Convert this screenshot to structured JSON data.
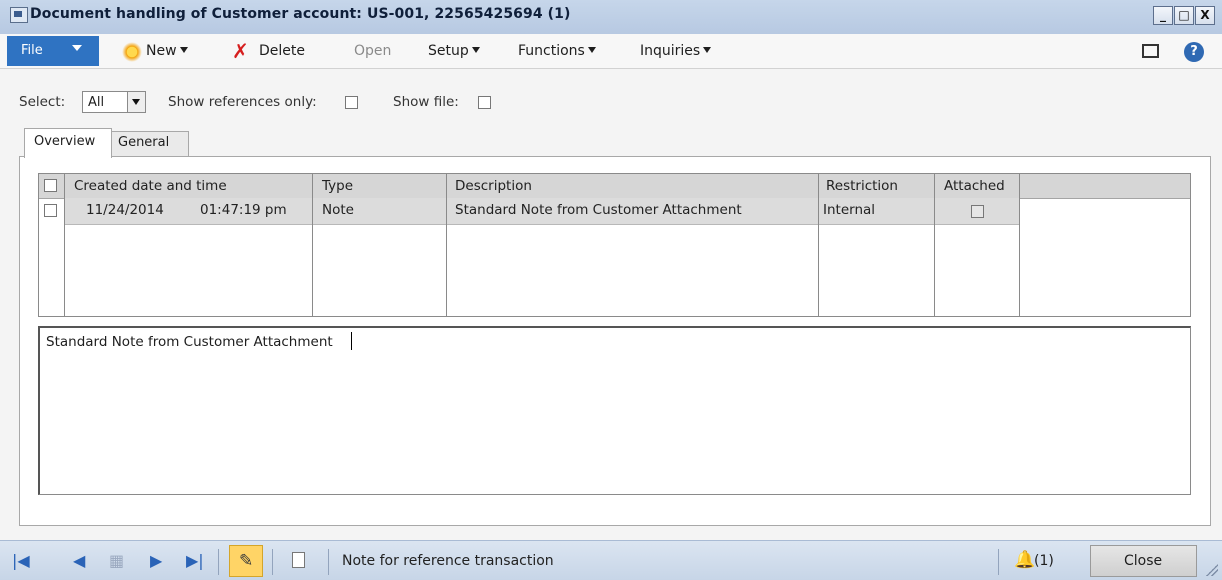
{
  "window": {
    "title": "Document handling of Customer account: US-001, 22565425694 (1)",
    "minimize": "_",
    "maximize": "□",
    "close": "X"
  },
  "toolbar": {
    "file_label": "File",
    "new_label": "New",
    "delete_label": "Delete",
    "open_label": "Open",
    "setup_label": "Setup",
    "functions_label": "Functions",
    "inquiries_label": "Inquiries",
    "help_label": "?",
    "delete_icon": "✗"
  },
  "filters": {
    "select_label": "Select:",
    "select_value": "All",
    "show_references_label": "Show references only:",
    "show_references_checked": false,
    "show_file_label": "Show file:",
    "show_file_checked": false
  },
  "tabs": [
    {
      "label": "Overview",
      "active": true
    },
    {
      "label": "General",
      "active": false
    }
  ],
  "grid": {
    "columns": [
      "Created date and time",
      "Type",
      "Description",
      "Restriction",
      "Attached"
    ],
    "rows": [
      {
        "date": "11/24/2014",
        "time": "01:47:19 pm",
        "type": "Note",
        "description": "Standard Note from Customer Attachment",
        "restriction": "Internal",
        "attached": false
      }
    ]
  },
  "note_text": "Standard Note from Customer Attachment",
  "statusbar": {
    "status_text": "Note for reference transaction",
    "notification_count": "(1)",
    "close_label": "Close",
    "nav_first": "|◀",
    "nav_prev": "◀",
    "nav_next": "▶",
    "nav_last": "▶|",
    "nav_grid": "▦",
    "edit_icon": "✎",
    "bell_icon": "🔔"
  },
  "colors": {
    "file_button": "#2f73c2",
    "titlebar": "#b7c9e2",
    "statusbar": "#c7d5e7",
    "selected_row": "#dcdcdc",
    "edit_highlight": "#ffd466"
  },
  "icons": [
    "window-app-icon",
    "new-star-icon",
    "delete-x-icon",
    "layout-icon",
    "help-icon",
    "first-record-icon",
    "previous-record-icon",
    "grid-view-icon",
    "next-record-icon",
    "last-record-icon",
    "edit-pencil-icon",
    "attachment-icon",
    "bell-icon",
    "resize-grip-icon"
  ]
}
